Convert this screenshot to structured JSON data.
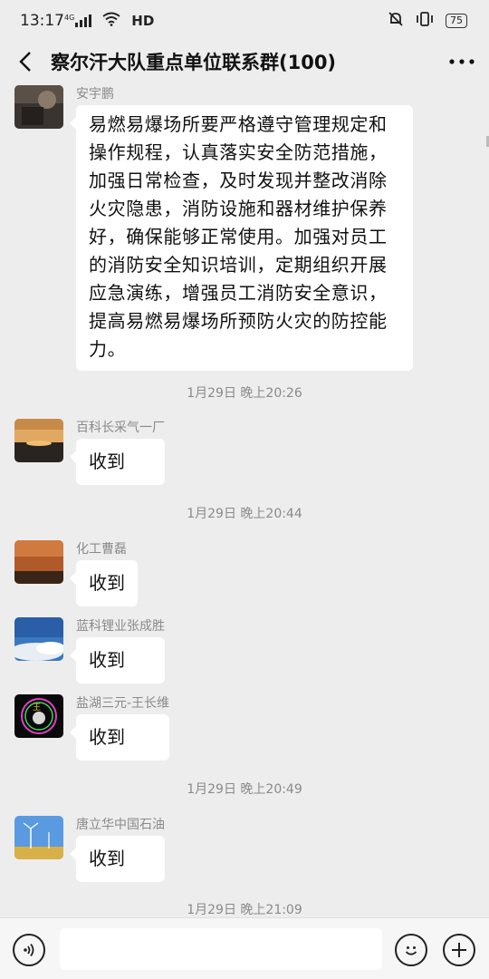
{
  "status": {
    "time": "13:17",
    "network": "4G",
    "hd": "HD",
    "battery": "75"
  },
  "header": {
    "title": "察尔汗大队重点单位联系群(100)"
  },
  "messages": [
    {
      "sender": "安宇鹏",
      "text": "易燃易爆场所要严格遵守管理规定和操作规程，认真落实安全防范措施，加强日常检查，及时发现并整改消除火灾隐患，消防设施和器材维护保养好，确保能够正常使用。加强对员工的消防安全知识培训，定期组织开展应急演练，增强员工消防安全意识，提高易燃易爆场所预防火灾的防控能力。"
    },
    {
      "time": "1月29日 晚上20:26"
    },
    {
      "sender": "百科长采气一厂",
      "text": "收到"
    },
    {
      "time": "1月29日 晚上20:44"
    },
    {
      "sender": "化工曹磊",
      "text": "收到"
    },
    {
      "sender": "蓝科锂业张成胜",
      "text": "收到"
    },
    {
      "sender": "盐湖三元-王长维",
      "text": "收到"
    },
    {
      "time": "1月29日 晚上20:49"
    },
    {
      "sender": "唐立华中国石油",
      "text": "收到"
    },
    {
      "time": "1月29日 晚上21:09"
    }
  ],
  "input": {
    "placeholder": ""
  },
  "icons": {
    "back": "back-arrow-icon",
    "more": "more-dots-icon",
    "voice": "voice-icon",
    "emoji": "emoji-icon",
    "plus": "plus-icon"
  }
}
